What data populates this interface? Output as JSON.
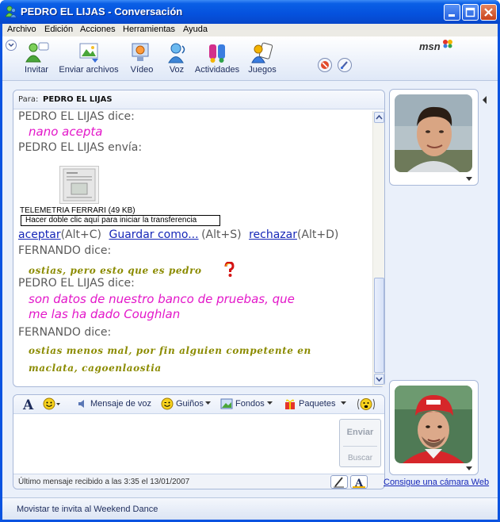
{
  "window": {
    "title": "PEDRO EL LIJAS - Conversación"
  },
  "menu": [
    "Archivo",
    "Edición",
    "Acciones",
    "Herramientas",
    "Ayuda"
  ],
  "toolbar": {
    "invite": "Invitar",
    "send_files": "Enviar archivos",
    "video": "Vídeo",
    "voice": "Voz",
    "activities": "Actividades",
    "games": "Juegos",
    "logo": "msn"
  },
  "conversation": {
    "to_label": "Para:",
    "to_name": "PEDRO EL LIJAS",
    "messages": {
      "m1_says": "PEDRO EL LIJAS dice:",
      "m1_text": "nano acepta",
      "m2_sends": "PEDRO EL LIJAS envía:",
      "file_name": "TELEMETRIA FERRARI (49 KB)",
      "file_hint": "Hacer doble clic aquí para iniciar la transferencia",
      "accept": "aceptar",
      "accept_key": "(Alt+C)",
      "save_as": "Guardar como...",
      "save_key": "(Alt+S)",
      "reject": "rechazar",
      "reject_key": "(Alt+D)",
      "m3_says": "FERNANDO dice:",
      "m3_text": "ostias, pero esto que es pedro",
      "m4_says": "PEDRO EL LIJAS dice:",
      "m4_text_1": "son datos de nuestro banco de pruebas, que",
      "m4_text_2": "me las ha dado Coughlan",
      "m5_says": "FERNANDO dice:",
      "m5_text_1": "ostias menos mal, por fin alguien competente en",
      "m5_text_2": "maclata, cagoenlaostia"
    }
  },
  "compose": {
    "voice_clip": "Mensaje de voz",
    "winks": "Guiños",
    "backgrounds": "Fondos",
    "packs": "Paquetes",
    "send": "Enviar",
    "search": "Buscar",
    "status": "Último mensaje recibido a las 3:35 el 13/01/2007"
  },
  "webcam_link": "Consigue una cámara Web",
  "ad": "Movistar te invita al Weekend Dance",
  "colors": {
    "pedro_text": "#e317c9",
    "fernando_text": "#8b8b00",
    "titlebar": "#0551dd",
    "link": "#1627b8"
  }
}
